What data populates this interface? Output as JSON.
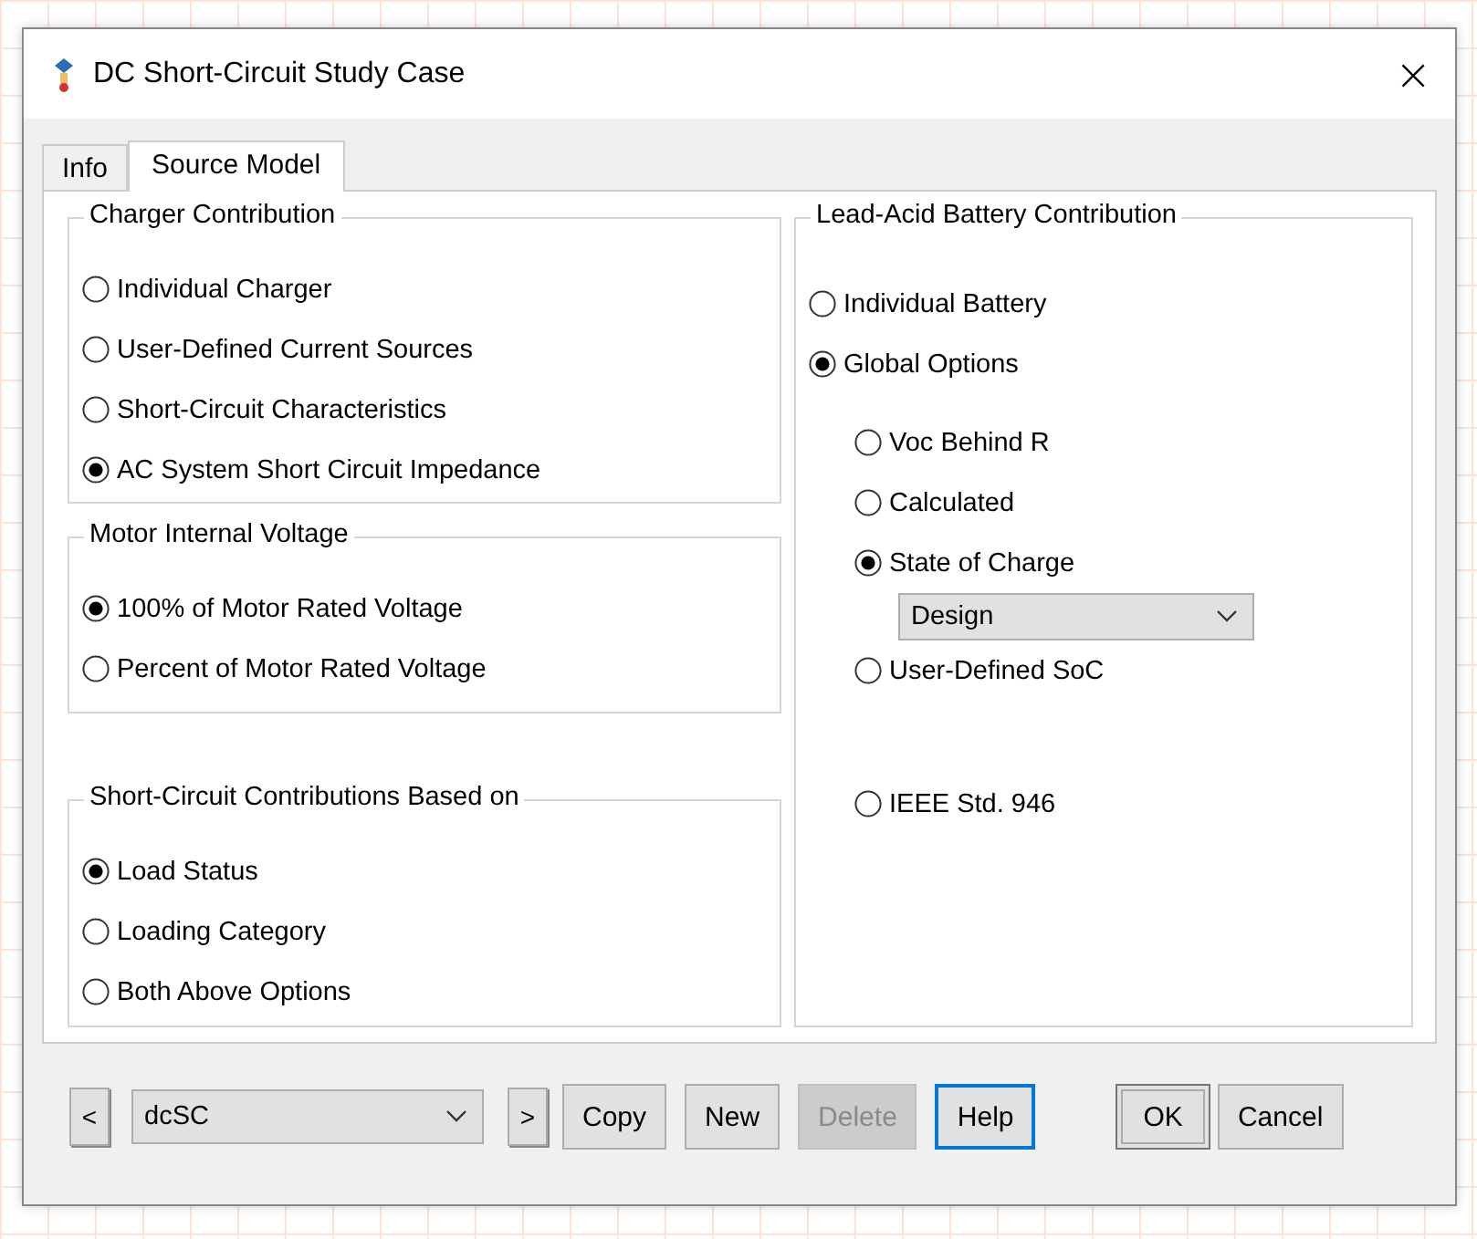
{
  "window": {
    "title": "DC Short-Circuit Study Case",
    "close": "×"
  },
  "tabs": [
    {
      "label": "Info",
      "selected": false
    },
    {
      "label": "Source Model",
      "selected": true
    }
  ],
  "left_groups": [
    {
      "title": "Charger Contribution",
      "options": [
        {
          "label": "Individual Charger",
          "selected": false
        },
        {
          "label": "User-Defined Current Sources",
          "selected": false
        },
        {
          "label": "Short-Circuit Characteristics",
          "selected": false
        },
        {
          "label": "AC System Short Circuit Impedance",
          "selected": true
        }
      ]
    },
    {
      "title": "Motor Internal Voltage",
      "options": [
        {
          "label": "100% of Motor Rated Voltage",
          "selected": true
        },
        {
          "label": "Percent of Motor Rated Voltage",
          "selected": false
        }
      ]
    },
    {
      "title": "Short-Circuit Contributions Based on",
      "options": [
        {
          "label": "Load Status",
          "selected": true
        },
        {
          "label": "Loading Category",
          "selected": false
        },
        {
          "label": "Both Above Options",
          "selected": false
        }
      ]
    }
  ],
  "battery_group": {
    "title": "Lead-Acid Battery Contribution",
    "options": [
      {
        "label": "Individual Battery",
        "selected": false
      },
      {
        "label": "Global Options",
        "selected": true,
        "children": [
          {
            "kind": "radio",
            "label": "Voc Behind R",
            "selected": false
          },
          {
            "kind": "radio",
            "label": "Calculated",
            "selected": false
          },
          {
            "kind": "radio",
            "label": "State of Charge",
            "selected": true
          },
          {
            "kind": "dropdown",
            "value": "Design"
          },
          {
            "kind": "radio",
            "label": "User-Defined SoC",
            "selected": false
          },
          {
            "kind": "radio",
            "label": "IEEE Std. 946",
            "selected": false
          }
        ]
      }
    ]
  },
  "footer": {
    "prev": "<",
    "case": "dcSC",
    "next": ">",
    "buttons": [
      {
        "label": "Copy",
        "disabled": false,
        "focused": false
      },
      {
        "label": "New",
        "disabled": false,
        "focused": false
      },
      {
        "label": "Delete",
        "disabled": true,
        "focused": false
      },
      {
        "label": "Help",
        "disabled": false,
        "focused": true
      }
    ],
    "dialog_buttons": [
      {
        "label": "OK",
        "default": true
      },
      {
        "label": "Cancel",
        "default": false
      }
    ]
  }
}
